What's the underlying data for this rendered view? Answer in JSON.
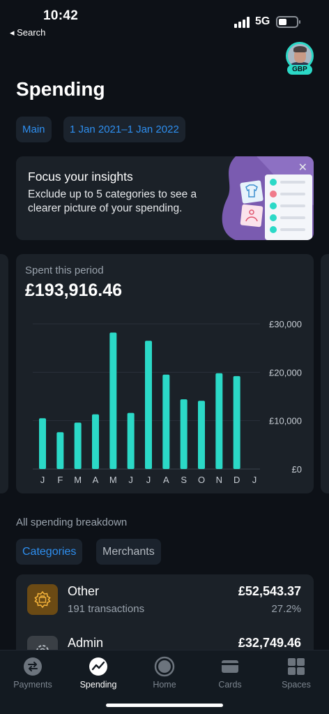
{
  "status_bar": {
    "time": "10:42",
    "back_label": "◂ Search",
    "network": "5G"
  },
  "header": {
    "title": "Spending",
    "currency_badge": "GBP"
  },
  "filters": {
    "account": "Main",
    "date_range": "1 Jan 2021–1 Jan 2022"
  },
  "insight_card": {
    "title": "Focus your insights",
    "body": "Exclude up to 5 categories to see a clearer picture of your spending.",
    "close_glyph": "✕"
  },
  "spent_card": {
    "label": "Spent this period",
    "amount": "£193,916.46"
  },
  "chart_data": {
    "type": "bar",
    "categories": [
      "J",
      "F",
      "M",
      "A",
      "M",
      "J",
      "J",
      "A",
      "S",
      "O",
      "N",
      "D",
      "J"
    ],
    "values": [
      10500,
      7600,
      9600,
      11300,
      28200,
      11600,
      26500,
      19500,
      14400,
      14100,
      19800,
      19200,
      null
    ],
    "ylim": [
      0,
      30000
    ],
    "y_ticks": [
      0,
      10000,
      20000,
      30000
    ],
    "y_tick_labels": [
      "£0",
      "£10,000",
      "£20,000",
      "£30,000"
    ],
    "bar_color": "#2bd9c7",
    "grid": true
  },
  "breakdown": {
    "label": "All spending breakdown",
    "tabs": [
      {
        "label": "Categories",
        "active": true
      },
      {
        "label": "Merchants",
        "active": false
      }
    ],
    "rows": [
      {
        "name": "Other",
        "subtitle": "191 transactions",
        "amount": "£52,543.37",
        "percent": "27.2%",
        "icon": "other-category-icon",
        "icon_bg": "#6b4a14",
        "icon_color": "#f3b23a"
      },
      {
        "name": "Admin",
        "subtitle": "",
        "amount": "£32,749.46",
        "percent": "",
        "icon": "admin-gear-icon",
        "icon_bg": "#3a3f45",
        "icon_color": "#b8bec5"
      }
    ]
  },
  "bottom_nav": {
    "items": [
      {
        "label": "Payments",
        "icon": "payments-icon",
        "active": false
      },
      {
        "label": "Spending",
        "icon": "spending-icon",
        "active": true
      },
      {
        "label": "Home",
        "icon": "home-icon",
        "active": false
      },
      {
        "label": "Cards",
        "icon": "cards-icon",
        "active": false
      },
      {
        "label": "Spaces",
        "icon": "spaces-icon",
        "active": false
      }
    ]
  }
}
